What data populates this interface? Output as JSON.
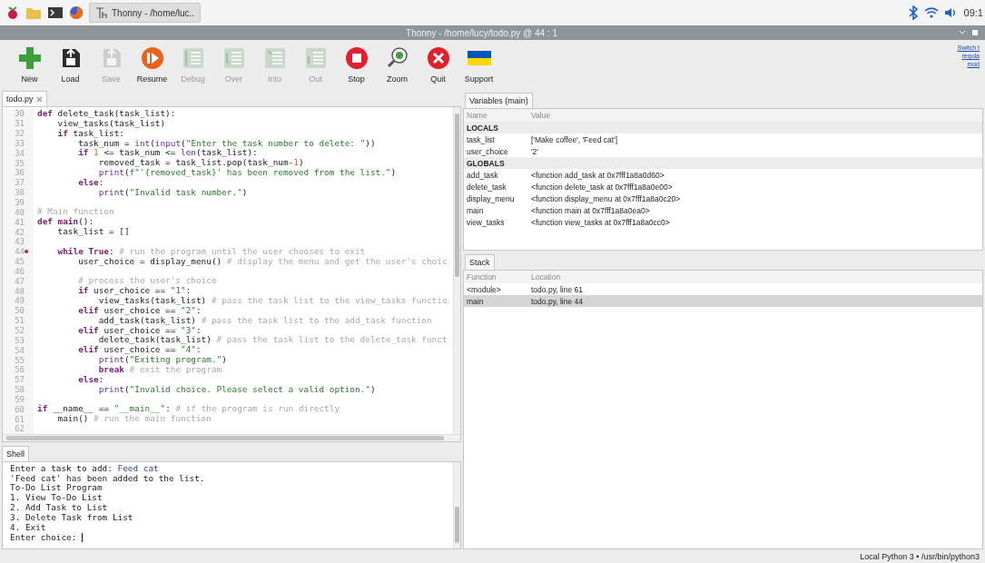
{
  "taskbar": {
    "task_button": {
      "title": "Thonny - /home/luc.."
    },
    "clock": "09:1"
  },
  "window": {
    "title": "Thonny - /home/lucy/todo.py @ 44 : 1"
  },
  "toolbar": {
    "buttons": [
      {
        "kind": "new",
        "label": "New",
        "disabled": false
      },
      {
        "kind": "load",
        "label": "Load",
        "disabled": false
      },
      {
        "kind": "save",
        "label": "Save",
        "disabled": true
      },
      {
        "kind": "resume",
        "label": "Resume",
        "disabled": false
      },
      {
        "kind": "debug",
        "label": "Debug",
        "disabled": true
      },
      {
        "kind": "over",
        "label": "Over",
        "disabled": true
      },
      {
        "kind": "into",
        "label": "Into",
        "disabled": true
      },
      {
        "kind": "out",
        "label": "Out",
        "disabled": true
      },
      {
        "kind": "stop",
        "label": "Stop",
        "disabled": false
      },
      {
        "kind": "zoom",
        "label": "Zoom",
        "disabled": false
      },
      {
        "kind": "quit",
        "label": "Quit",
        "disabled": false
      },
      {
        "kind": "support",
        "label": "Support",
        "disabled": false
      }
    ],
    "mode_link": [
      "Switch t",
      "regula",
      "mod"
    ]
  },
  "editor": {
    "tab": "todo.py",
    "lines": [
      {
        "number": "30",
        "tokens": [
          {
            "kind": "keyword",
            "text": "def"
          },
          {
            "kind": "plain",
            "text": " delete_task(task_list):"
          }
        ]
      },
      {
        "number": "31",
        "tokens": [
          {
            "kind": "plain",
            "text": "    view_tasks(task_list)"
          }
        ]
      },
      {
        "number": "32",
        "tokens": [
          {
            "kind": "keyword",
            "text": "    if"
          },
          {
            "kind": "plain",
            "text": " task_list:"
          }
        ]
      },
      {
        "number": "33",
        "tokens": [
          {
            "kind": "plain",
            "text": "        task_num = "
          },
          {
            "kind": "builtin",
            "text": "int"
          },
          {
            "kind": "plain",
            "text": "("
          },
          {
            "kind": "builtin",
            "text": "input"
          },
          {
            "kind": "plain",
            "text": "("
          },
          {
            "kind": "string",
            "text": "\"Enter the task number to delete: \""
          },
          {
            "kind": "plain",
            "text": "))"
          }
        ]
      },
      {
        "number": "34",
        "tokens": [
          {
            "kind": "keyword",
            "text": "        if"
          },
          {
            "kind": "number",
            "text": " 1"
          },
          {
            "kind": "plain",
            "text": " <= task_num <= "
          },
          {
            "kind": "builtin",
            "text": "len"
          },
          {
            "kind": "plain",
            "text": "(task_list):"
          }
        ]
      },
      {
        "number": "35",
        "tokens": [
          {
            "kind": "plain",
            "text": "            removed_task = task_list.pop(task_num-"
          },
          {
            "kind": "number",
            "text": "1"
          },
          {
            "kind": "plain",
            "text": ")"
          }
        ]
      },
      {
        "number": "36",
        "tokens": [
          {
            "kind": "builtin",
            "text": "            print"
          },
          {
            "kind": "plain",
            "text": "("
          },
          {
            "kind": "string",
            "text": "f\"'{removed_task}' has been removed from the list.\""
          },
          {
            "kind": "plain",
            "text": ")"
          }
        ]
      },
      {
        "number": "37",
        "tokens": [
          {
            "kind": "keyword",
            "text": "        else"
          },
          {
            "kind": "plain",
            "text": ":"
          }
        ]
      },
      {
        "number": "38",
        "tokens": [
          {
            "kind": "builtin",
            "text": "            print"
          },
          {
            "kind": "plain",
            "text": "("
          },
          {
            "kind": "string",
            "text": "\"Invalid task number.\""
          },
          {
            "kind": "plain",
            "text": ")"
          }
        ]
      },
      {
        "number": "39"
      },
      {
        "number": "40",
        "tokens": [
          {
            "kind": "comment",
            "text": "# Main function"
          }
        ]
      },
      {
        "number": "41",
        "tokens": [
          {
            "kind": "keyword",
            "text": "def main"
          },
          {
            "kind": "plain",
            "text": "():"
          }
        ]
      },
      {
        "number": "42",
        "tokens": [
          {
            "kind": "plain",
            "text": "    task_list = []"
          }
        ]
      },
      {
        "number": "43"
      },
      {
        "number": "44",
        "breakpoint": true,
        "tokens": [
          {
            "kind": "keyword",
            "text": "    while True"
          },
          {
            "kind": "plain",
            "text": ": "
          },
          {
            "kind": "comment",
            "text": "# run the program until the user chooses to exit"
          }
        ]
      },
      {
        "number": "45",
        "tokens": [
          {
            "kind": "plain",
            "text": "        user_choice = display_menu() "
          },
          {
            "kind": "comment",
            "text": "# display the menu and get the user's choic"
          }
        ]
      },
      {
        "number": "46"
      },
      {
        "number": "47",
        "tokens": [
          {
            "kind": "comment",
            "text": "        # process the user's choice"
          }
        ]
      },
      {
        "number": "48",
        "tokens": [
          {
            "kind": "keyword",
            "text": "        if"
          },
          {
            "kind": "plain",
            "text": " user_choice == "
          },
          {
            "kind": "string",
            "text": "\"1\""
          },
          {
            "kind": "plain",
            "text": ":"
          }
        ]
      },
      {
        "number": "49",
        "tokens": [
          {
            "kind": "plain",
            "text": "            view_tasks(task_list) "
          },
          {
            "kind": "comment",
            "text": "# pass the task list to the view_tasks functio"
          }
        ]
      },
      {
        "number": "50",
        "tokens": [
          {
            "kind": "keyword",
            "text": "        elif"
          },
          {
            "kind": "plain",
            "text": " user_choice == "
          },
          {
            "kind": "string",
            "text": "\"2\""
          },
          {
            "kind": "plain",
            "text": ":"
          }
        ]
      },
      {
        "number": "51",
        "tokens": [
          {
            "kind": "plain",
            "text": "            add_task(task_list) "
          },
          {
            "kind": "comment",
            "text": "# pass the task list to the add_task function"
          }
        ]
      },
      {
        "number": "52",
        "tokens": [
          {
            "kind": "keyword",
            "text": "        elif"
          },
          {
            "kind": "plain",
            "text": " user_choice == "
          },
          {
            "kind": "string",
            "text": "\"3\""
          },
          {
            "kind": "plain",
            "text": ":"
          }
        ]
      },
      {
        "number": "53",
        "tokens": [
          {
            "kind": "plain",
            "text": "            delete_task(task_list) "
          },
          {
            "kind": "comment",
            "text": "# pass the task list to the delete_task funct"
          }
        ]
      },
      {
        "number": "54",
        "tokens": [
          {
            "kind": "keyword",
            "text": "        elif"
          },
          {
            "kind": "plain",
            "text": " user_choice == "
          },
          {
            "kind": "string",
            "text": "\"4\""
          },
          {
            "kind": "plain",
            "text": ":"
          }
        ]
      },
      {
        "number": "55",
        "tokens": [
          {
            "kind": "builtin",
            "text": "            print"
          },
          {
            "kind": "plain",
            "text": "("
          },
          {
            "kind": "string",
            "text": "\"Exiting program.\""
          },
          {
            "kind": "plain",
            "text": ")"
          }
        ]
      },
      {
        "number": "56",
        "tokens": [
          {
            "kind": "keyword",
            "text": "            break"
          },
          {
            "kind": "comment",
            "text": " # exit the program"
          }
        ]
      },
      {
        "number": "57",
        "tokens": [
          {
            "kind": "keyword",
            "text": "        else"
          },
          {
            "kind": "plain",
            "text": ":"
          }
        ]
      },
      {
        "number": "58",
        "tokens": [
          {
            "kind": "builtin",
            "text": "            print"
          },
          {
            "kind": "plain",
            "text": "("
          },
          {
            "kind": "string",
            "text": "\"Invalid choice. Please select a valid option.\""
          },
          {
            "kind": "plain",
            "text": ")"
          }
        ]
      },
      {
        "number": "59"
      },
      {
        "number": "60",
        "tokens": [
          {
            "kind": "keyword",
            "text": "if"
          },
          {
            "kind": "plain",
            "text": " __name__ == "
          },
          {
            "kind": "string",
            "text": "\"__main__\""
          },
          {
            "kind": "plain",
            "text": ": "
          },
          {
            "kind": "comment",
            "text": "# if the program is run directly"
          }
        ]
      },
      {
        "number": "61",
        "tokens": [
          {
            "kind": "plain",
            "text": "    main() "
          },
          {
            "kind": "comment",
            "text": "# run the main function"
          }
        ]
      },
      {
        "number": "62"
      }
    ]
  },
  "shell": {
    "tab": "Shell",
    "lines": [
      {
        "segments": [
          {
            "kind": "output",
            "text": "Enter a task to add: "
          },
          {
            "kind": "input",
            "text": "Feed cat"
          }
        ]
      },
      {
        "segments": [
          {
            "kind": "output",
            "text": "'Feed cat' has been added to the list."
          }
        ]
      },
      {
        "segments": [
          {
            "kind": "output",
            "text": "To-Do List Program"
          }
        ]
      },
      {
        "segments": [
          {
            "kind": "output",
            "text": "1. View To-Do List"
          }
        ]
      },
      {
        "segments": [
          {
            "kind": "output",
            "text": "2. Add Task to List"
          }
        ]
      },
      {
        "segments": [
          {
            "kind": "output",
            "text": "3. Delete Task from List"
          }
        ]
      },
      {
        "segments": [
          {
            "kind": "output",
            "text": "4. Exit"
          }
        ]
      },
      {
        "segments": [
          {
            "kind": "output",
            "text": "Enter choice: "
          }
        ]
      }
    ]
  },
  "variables": {
    "tab": "Variables (main)",
    "columns": [
      "Name",
      "Value"
    ],
    "rows": [
      {
        "kind": "section",
        "name": "LOCALS"
      },
      {
        "kind": "variable",
        "name": "task_list",
        "value": "['Make coffee', 'Feed cat']"
      },
      {
        "kind": "variable",
        "name": "user_choice",
        "value": "'2'"
      },
      {
        "kind": "section",
        "name": "GLOBALS"
      },
      {
        "kind": "variable",
        "name": "add_task",
        "value": "<function add_task at 0x7fff1a8a0d60>"
      },
      {
        "kind": "variable",
        "name": "delete_task",
        "value": "<function delete_task at 0x7fff1a8a0e00>"
      },
      {
        "kind": "variable",
        "name": "display_menu",
        "value": "<function display_menu at 0x7fff1a8a0c20>"
      },
      {
        "kind": "variable",
        "name": "main",
        "value": "<function main at 0x7fff1a8a0ea0>"
      },
      {
        "kind": "variable",
        "name": "view_tasks",
        "value": "<function view_tasks at 0x7fff1a8a0cc0>"
      }
    ]
  },
  "stack": {
    "tab": "Stack",
    "columns": [
      "Function",
      "Location"
    ],
    "rows": [
      {
        "function": "<module>",
        "location": "todo.py, line 61",
        "selected": false
      },
      {
        "function": "main",
        "location": "todo.py, line 44",
        "selected": true
      }
    ]
  },
  "status_bar": {
    "interpreter": "Local Python 3 • /usr/bin/python3"
  }
}
